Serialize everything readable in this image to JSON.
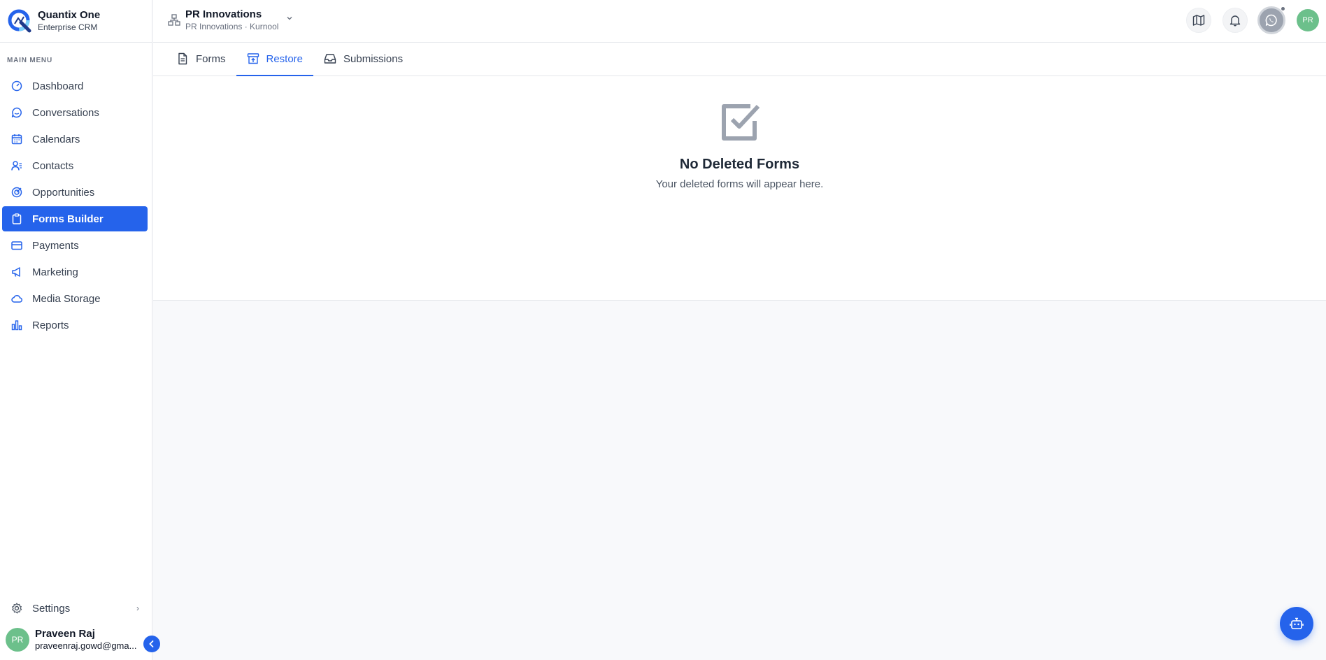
{
  "brand": {
    "name": "Quantix One",
    "subtitle": "Enterprise CRM"
  },
  "sidebar": {
    "heading": "MAIN MENU",
    "items": [
      {
        "label": "Dashboard",
        "icon": "gauge-icon",
        "active": false
      },
      {
        "label": "Conversations",
        "icon": "chat-icon",
        "active": false
      },
      {
        "label": "Calendars",
        "icon": "calendar-icon",
        "active": false
      },
      {
        "label": "Contacts",
        "icon": "contacts-icon",
        "active": false
      },
      {
        "label": "Opportunities",
        "icon": "target-icon",
        "active": false
      },
      {
        "label": "Forms Builder",
        "icon": "clipboard-icon",
        "active": true
      },
      {
        "label": "Payments",
        "icon": "card-icon",
        "active": false
      },
      {
        "label": "Marketing",
        "icon": "megaphone-icon",
        "active": false
      },
      {
        "label": "Media Storage",
        "icon": "cloud-icon",
        "active": false
      },
      {
        "label": "Reports",
        "icon": "bar-chart-icon",
        "active": false
      }
    ],
    "settings_label": "Settings",
    "user": {
      "initials": "PR",
      "name": "Praveen Raj",
      "email": "praveenraj.gowd@gma..."
    }
  },
  "header": {
    "org_name": "PR Innovations",
    "org_sub": "PR Innovations · Kurnool",
    "avatar_initials": "PR"
  },
  "tabs": [
    {
      "label": "Forms",
      "icon": "document-icon",
      "active": false
    },
    {
      "label": "Restore",
      "icon": "archive-restore-icon",
      "active": true
    },
    {
      "label": "Submissions",
      "icon": "inbox-icon",
      "active": false
    }
  ],
  "empty_state": {
    "title": "No Deleted Forms",
    "message": "Your deleted forms will appear here."
  },
  "colors": {
    "accent": "#2563eb",
    "avatar": "#6cc08b",
    "sidebar_bg": "#ffffff",
    "page_bg": "#f8f9fb"
  }
}
